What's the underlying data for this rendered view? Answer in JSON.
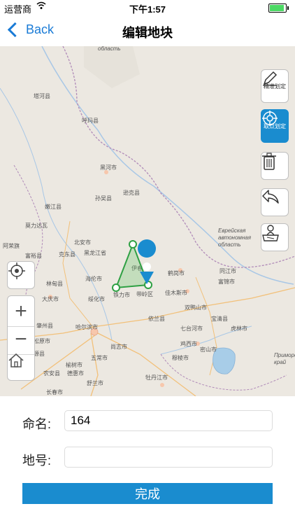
{
  "status_bar": {
    "carrier": "运营商",
    "wifi": "⌔",
    "time": "下午1:57",
    "battery_level": 0.9
  },
  "nav": {
    "back_label": "Back",
    "title": "编辑地块"
  },
  "map": {
    "labels": [
      {
        "text": "область",
        "id": "oblast-top"
      },
      {
        "text": "塔河县",
        "id": "tahe"
      },
      {
        "text": "呼玛县",
        "id": "huma"
      },
      {
        "text": "黑河市",
        "id": "heihe"
      },
      {
        "text": "逊克县",
        "id": "xunke"
      },
      {
        "text": "孙吴县",
        "id": "sunwu"
      },
      {
        "text": "嫩江县",
        "id": "nenjiang"
      },
      {
        "text": "莫力达瓦",
        "id": "molidawa"
      },
      {
        "text": "北安市",
        "id": "beian"
      },
      {
        "text": "黑龙江省",
        "id": "heilongjiang"
      },
      {
        "text": "克东县",
        "id": "kedong"
      },
      {
        "text": "阿荣旗",
        "id": "arong"
      },
      {
        "text": "富裕县",
        "id": "fuyu"
      },
      {
        "text": "海伦市",
        "id": "hailun"
      },
      {
        "text": "伊春",
        "id": "yichun"
      },
      {
        "text": "鹤岗市",
        "id": "hegang"
      },
      {
        "text": "同江市",
        "id": "tongjiang"
      },
      {
        "text": "富锦市",
        "id": "fujin"
      },
      {
        "text": "林甸县",
        "id": "lindian"
      },
      {
        "text": "绥化市",
        "id": "suihua"
      },
      {
        "text": "铁力市",
        "id": "tieli"
      },
      {
        "text": "带岭区",
        "id": "dailing"
      },
      {
        "text": "佳木斯市",
        "id": "jiamusi"
      },
      {
        "text": "双鸭山市",
        "id": "shuangyashan"
      },
      {
        "text": "大庆市",
        "id": "daqing"
      },
      {
        "text": "依兰县",
        "id": "yilan"
      },
      {
        "text": "宝清县",
        "id": "baoqing"
      },
      {
        "text": "哈尔滨市",
        "id": "harbin"
      },
      {
        "text": "七台河市",
        "id": "qitaihe"
      },
      {
        "text": "虎林市",
        "id": "hulin"
      },
      {
        "text": "肇州县",
        "id": "zhaozhou"
      },
      {
        "text": "尚志市",
        "id": "shangzhi"
      },
      {
        "text": "鸡西市",
        "id": "jixi"
      },
      {
        "text": "密山市",
        "id": "mishan"
      },
      {
        "text": "五常市",
        "id": "wuchang"
      },
      {
        "text": "穆棱市",
        "id": "muling"
      },
      {
        "text": "榆树市",
        "id": "yushu"
      },
      {
        "text": "舒兰市",
        "id": "shulan"
      },
      {
        "text": "德惠市",
        "id": "dehui"
      },
      {
        "text": "牡丹江市",
        "id": "mudanjiang"
      },
      {
        "text": "长春市",
        "id": "changchun"
      },
      {
        "text": "松原市",
        "id": "songyuan"
      },
      {
        "text": "农安县",
        "id": "nongan"
      },
      {
        "text": "肇源县",
        "id": "zhaoyuan"
      },
      {
        "text": "Еврейская автономная область",
        "id": "jewish-ao"
      },
      {
        "text": "Приморский край",
        "id": "primorsky"
      }
    ]
  },
  "tools": {
    "draw": {
      "label": "精准划定",
      "icon": "pencil-icon"
    },
    "point": {
      "label": "取点划定",
      "icon": "crosshair-icon"
    },
    "delete": {
      "icon": "trash-icon"
    },
    "undo": {
      "icon": "undo-arrow-icon"
    },
    "location": {
      "icon": "map-person-icon"
    }
  },
  "map_controls": {
    "locate": "locate-icon",
    "zoom_in": "+",
    "zoom_out": "−",
    "home": "home-icon"
  },
  "form": {
    "name_label": "命名:",
    "name_value": "164",
    "number_label": "地号:",
    "number_value": "",
    "done_label": "完成"
  }
}
